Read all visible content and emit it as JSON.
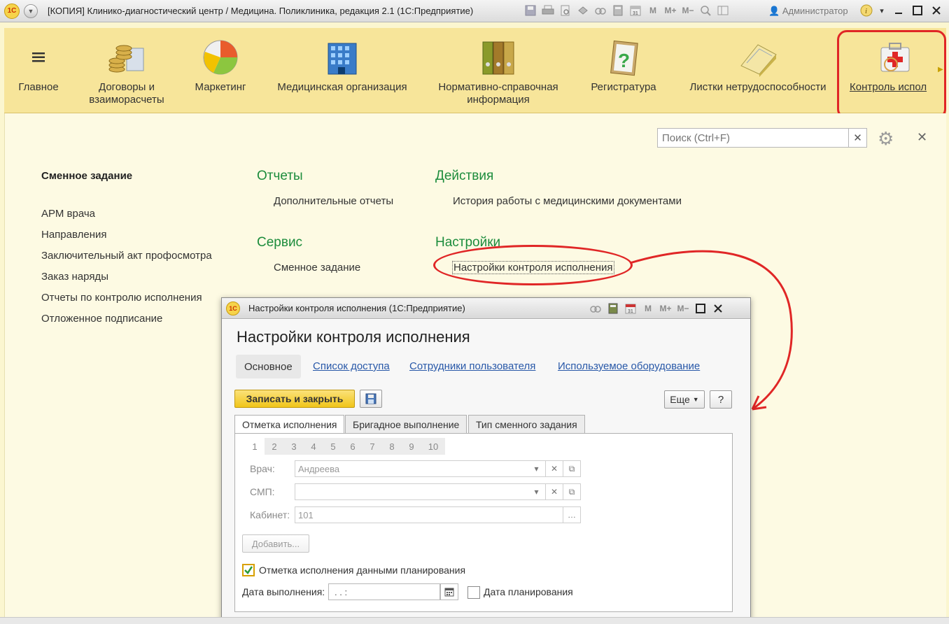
{
  "window": {
    "title": "[КОПИЯ] Клинико-диагностический центр / Медицина. Поликлиника, редакция 2.1  (1С:Предприятие)",
    "user": "Администратор",
    "logo_text": "1С",
    "toolbar_icons": [
      "save-icon",
      "print-icon",
      "preview-icon",
      "history-icon",
      "link-icon",
      "calculator-icon",
      "calendar-icon",
      "M",
      "M+",
      "M−",
      "zoom-icon",
      "panels-icon"
    ]
  },
  "sections": [
    {
      "label": "Главное",
      "icon": "menu-icon"
    },
    {
      "label": "Договоры и взаиморасчеты",
      "icon": "coins-icon"
    },
    {
      "label": "Маркетинг",
      "icon": "pie-chart-icon"
    },
    {
      "label": "Медицинская организация",
      "icon": "building-icon"
    },
    {
      "label": "Нормативно-справочная информация",
      "icon": "binders-icon"
    },
    {
      "label": "Регистратура",
      "icon": "clipboard-question-icon"
    },
    {
      "label": "Листки нетрудоспособности",
      "icon": "notepad-icon"
    },
    {
      "label": "Контроль испол",
      "icon": "first-aid-kit-icon"
    }
  ],
  "search": {
    "placeholder": "Поиск (Ctrl+F)"
  },
  "left_nav": {
    "heading": "Сменное задание",
    "items": [
      "АРМ врача",
      "Направления",
      "Заключительный акт профосмотра",
      "Заказ наряды",
      "Отчеты по контролю исполнения",
      "Отложенное подписание"
    ]
  },
  "reports": {
    "heading": "Отчеты",
    "items": [
      "Дополнительные отчеты"
    ]
  },
  "service": {
    "heading": "Сервис",
    "items": [
      "Сменное задание"
    ]
  },
  "actions": {
    "heading": "Действия",
    "items": [
      "История работы с медицинскими документами"
    ]
  },
  "settings": {
    "heading": "Настройки",
    "items": [
      "Настройки контроля исполнения"
    ]
  },
  "dialog": {
    "window_title": "Настройки контроля исполнения  (1С:Предприятие)",
    "form_title": "Настройки контроля исполнения",
    "form_tabs": [
      "Основное",
      "Список доступа",
      "Сотрудники пользователя",
      "Используемое оборудование"
    ],
    "save_close_label": "Записать и закрыть",
    "more_label": "Еще",
    "help_label": "?",
    "panel_tabs": [
      "Отметка исполнения",
      "Бригадное выполнение",
      "Тип сменного задания"
    ],
    "numbers": [
      "1",
      "2",
      "3",
      "4",
      "5",
      "6",
      "7",
      "8",
      "9",
      "10"
    ],
    "fields": {
      "doctor_label": "Врач:",
      "doctor_value": "Андреева",
      "smp_label": "СМП:",
      "smp_value": "",
      "cabinet_label": "Кабинет:",
      "cabinet_value": "101"
    },
    "add_label": "Добавить...",
    "plan_check_label": "Отметка исполнения данными планирования",
    "plan_checked": true,
    "exec_date_label": "Дата выполнения:",
    "exec_date_value": " .  .     :  ",
    "plan_date_label": "Дата планирования",
    "plan_date_checked": false
  }
}
